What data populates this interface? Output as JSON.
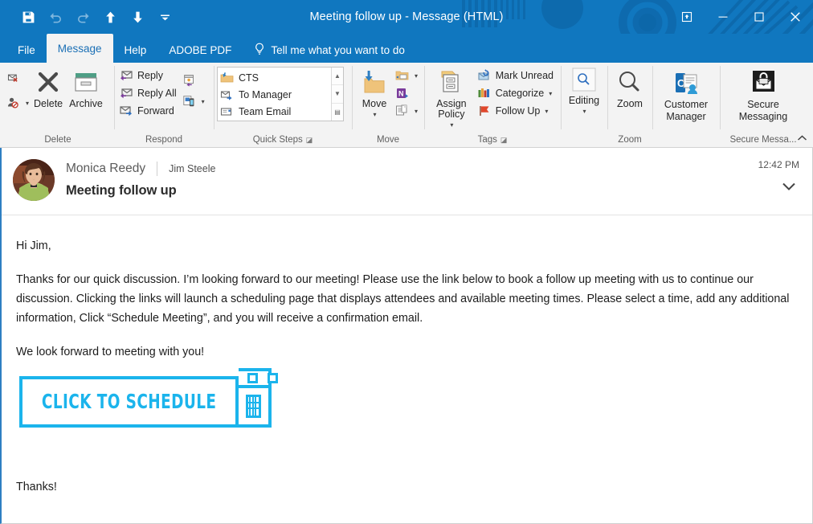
{
  "window": {
    "title": "Meeting follow up  -  Message (HTML)",
    "brand_blue": "#1077BF",
    "controls": {
      "restore_down_label": "Restore Down",
      "minimize_label": "Minimize",
      "maximize_label": "Maximize",
      "close_label": "Close"
    }
  },
  "quick_access": [
    {
      "name": "save-icon",
      "label": "Save"
    },
    {
      "name": "undo-icon",
      "label": "Undo"
    },
    {
      "name": "redo-icon",
      "label": "Redo"
    },
    {
      "name": "previous-item-icon",
      "label": "Previous Item"
    },
    {
      "name": "next-item-icon",
      "label": "Next Item"
    },
    {
      "name": "customize-quick-access-toolbar-icon",
      "label": "Customize Quick Access Toolbar"
    }
  ],
  "tabs": [
    {
      "label": "File",
      "active": false
    },
    {
      "label": "Message",
      "active": true
    },
    {
      "label": "Help",
      "active": false
    },
    {
      "label": "ADOBE PDF",
      "active": false
    }
  ],
  "tell_me": {
    "label": "Tell me what you want to do",
    "icon": "lightbulb-icon"
  },
  "ribbon": {
    "groups": [
      {
        "label": "Delete",
        "has_dialog_launcher": false,
        "small_buttons": [
          {
            "label": "",
            "icon": "ignore-icon"
          },
          {
            "label": "",
            "icon": "block-sender-icon",
            "has_caret": true
          }
        ],
        "big_buttons": [
          {
            "label": "Delete",
            "icon": "delete-x-icon"
          },
          {
            "label": "Archive",
            "icon": "archive-box-icon"
          }
        ]
      },
      {
        "label": "Respond",
        "has_dialog_launcher": false,
        "items": [
          {
            "label": "Reply",
            "icon": "reply-icon"
          },
          {
            "label": "Reply All",
            "icon": "reply-all-icon"
          },
          {
            "label": "Forward",
            "icon": "forward-icon"
          }
        ],
        "extra": [
          {
            "label": "",
            "icon": "meeting-icon"
          },
          {
            "label": "",
            "icon": "more-respond-icon",
            "has_caret": true
          }
        ]
      },
      {
        "label": "Quick Steps",
        "has_dialog_launcher": true,
        "items": [
          {
            "label": "CTS",
            "icon": "move-to-folder-icon"
          },
          {
            "label": "To Manager",
            "icon": "to-manager-icon"
          },
          {
            "label": "Team Email",
            "icon": "team-email-icon"
          }
        ],
        "scroll": [
          "up",
          "down",
          "more"
        ]
      },
      {
        "label": "Move",
        "has_dialog_launcher": false,
        "big_buttons": [
          {
            "label": "Move",
            "icon": "move-folder-icon",
            "has_caret": true
          }
        ],
        "small_buttons": [
          {
            "label": "",
            "icon": "rules-icon",
            "has_caret": true
          },
          {
            "label": "",
            "icon": "onenote-icon"
          },
          {
            "label": "",
            "icon": "actions-icon",
            "has_caret": true
          }
        ]
      },
      {
        "label": "Tags",
        "has_dialog_launcher": true,
        "big_buttons": [
          {
            "label": "Assign Policy",
            "icon": "assign-policy-icon",
            "has_caret": true
          }
        ],
        "items": [
          {
            "label": "Mark Unread",
            "icon": "mark-unread-icon"
          },
          {
            "label": "Categorize",
            "icon": "categorize-icon",
            "has_caret": true
          },
          {
            "label": "Follow Up",
            "icon": "follow-up-flag-icon",
            "has_caret": true
          }
        ]
      },
      {
        "label": "Zoom",
        "has_dialog_launcher": false,
        "big_buttons": [
          {
            "label": "Editing",
            "icon": "editing-magnifier-icon",
            "has_caret": true
          }
        ]
      },
      {
        "label": "Zoom",
        "has_dialog_launcher": false,
        "big_buttons": [
          {
            "label": "Zoom",
            "icon": "zoom-magnifier-icon"
          }
        ]
      },
      {
        "label": "",
        "has_dialog_launcher": false,
        "big_buttons": [
          {
            "label": "Customer Manager",
            "icon": "customer-manager-icon"
          }
        ]
      },
      {
        "label": "Secure Messa...",
        "has_dialog_launcher": false,
        "big_buttons": [
          {
            "label": "Secure Messaging",
            "icon": "secure-messaging-icon"
          }
        ]
      }
    ],
    "collapse_label": "Collapse the Ribbon"
  },
  "message": {
    "sender": "Monica Reedy",
    "recipient": "Jim Steele",
    "subject": "Meeting follow up",
    "time": "12:42 PM",
    "expand_icon": "chevron-down-icon",
    "avatar_alt": "Monica Reedy profile photo",
    "body": {
      "greeting": "Hi Jim,",
      "paragraph1": "Thanks for our quick discussion. I’m looking forward to our meeting! Please use the link below to book a follow up meeting with us to continue our discussion. Clicking the links will launch a scheduling page that displays attendees and available meeting times. Please select a time, add any additional information, Click “Schedule Meeting”, and you will receive a confirmation email.",
      "paragraph2": "We look forward to meeting with you!",
      "cta_label": "CLICK TO SCHEDULE",
      "cta_color": "#1BB4EC",
      "cta_icon": "calendar-icon",
      "closing": "Thanks!"
    }
  }
}
